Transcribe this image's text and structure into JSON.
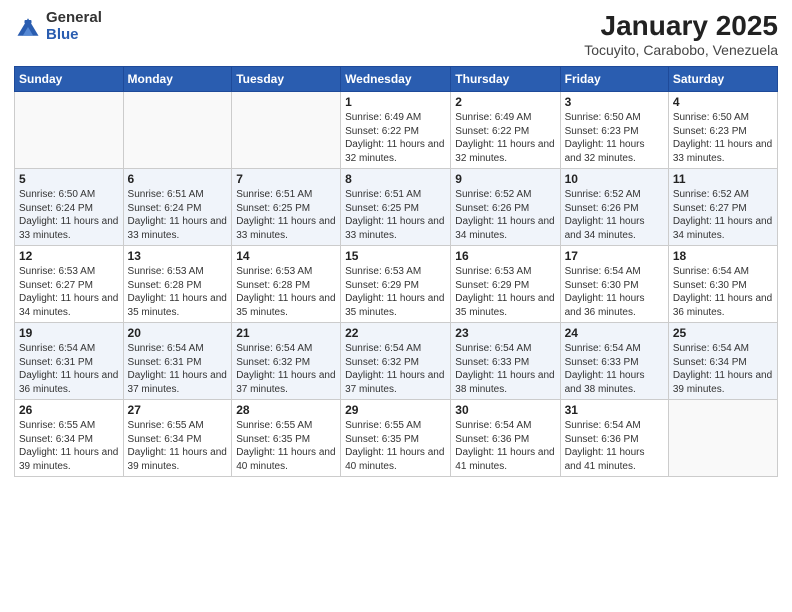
{
  "header": {
    "logo_general": "General",
    "logo_blue": "Blue",
    "title": "January 2025",
    "subtitle": "Tocuyito, Carabobo, Venezuela"
  },
  "days_of_week": [
    "Sunday",
    "Monday",
    "Tuesday",
    "Wednesday",
    "Thursday",
    "Friday",
    "Saturday"
  ],
  "weeks": [
    [
      {
        "day": "",
        "info": ""
      },
      {
        "day": "",
        "info": ""
      },
      {
        "day": "",
        "info": ""
      },
      {
        "day": "1",
        "info": "Sunrise: 6:49 AM\nSunset: 6:22 PM\nDaylight: 11 hours and 32 minutes."
      },
      {
        "day": "2",
        "info": "Sunrise: 6:49 AM\nSunset: 6:22 PM\nDaylight: 11 hours and 32 minutes."
      },
      {
        "day": "3",
        "info": "Sunrise: 6:50 AM\nSunset: 6:23 PM\nDaylight: 11 hours and 32 minutes."
      },
      {
        "day": "4",
        "info": "Sunrise: 6:50 AM\nSunset: 6:23 PM\nDaylight: 11 hours and 33 minutes."
      }
    ],
    [
      {
        "day": "5",
        "info": "Sunrise: 6:50 AM\nSunset: 6:24 PM\nDaylight: 11 hours and 33 minutes."
      },
      {
        "day": "6",
        "info": "Sunrise: 6:51 AM\nSunset: 6:24 PM\nDaylight: 11 hours and 33 minutes."
      },
      {
        "day": "7",
        "info": "Sunrise: 6:51 AM\nSunset: 6:25 PM\nDaylight: 11 hours and 33 minutes."
      },
      {
        "day": "8",
        "info": "Sunrise: 6:51 AM\nSunset: 6:25 PM\nDaylight: 11 hours and 33 minutes."
      },
      {
        "day": "9",
        "info": "Sunrise: 6:52 AM\nSunset: 6:26 PM\nDaylight: 11 hours and 34 minutes."
      },
      {
        "day": "10",
        "info": "Sunrise: 6:52 AM\nSunset: 6:26 PM\nDaylight: 11 hours and 34 minutes."
      },
      {
        "day": "11",
        "info": "Sunrise: 6:52 AM\nSunset: 6:27 PM\nDaylight: 11 hours and 34 minutes."
      }
    ],
    [
      {
        "day": "12",
        "info": "Sunrise: 6:53 AM\nSunset: 6:27 PM\nDaylight: 11 hours and 34 minutes."
      },
      {
        "day": "13",
        "info": "Sunrise: 6:53 AM\nSunset: 6:28 PM\nDaylight: 11 hours and 35 minutes."
      },
      {
        "day": "14",
        "info": "Sunrise: 6:53 AM\nSunset: 6:28 PM\nDaylight: 11 hours and 35 minutes."
      },
      {
        "day": "15",
        "info": "Sunrise: 6:53 AM\nSunset: 6:29 PM\nDaylight: 11 hours and 35 minutes."
      },
      {
        "day": "16",
        "info": "Sunrise: 6:53 AM\nSunset: 6:29 PM\nDaylight: 11 hours and 35 minutes."
      },
      {
        "day": "17",
        "info": "Sunrise: 6:54 AM\nSunset: 6:30 PM\nDaylight: 11 hours and 36 minutes."
      },
      {
        "day": "18",
        "info": "Sunrise: 6:54 AM\nSunset: 6:30 PM\nDaylight: 11 hours and 36 minutes."
      }
    ],
    [
      {
        "day": "19",
        "info": "Sunrise: 6:54 AM\nSunset: 6:31 PM\nDaylight: 11 hours and 36 minutes."
      },
      {
        "day": "20",
        "info": "Sunrise: 6:54 AM\nSunset: 6:31 PM\nDaylight: 11 hours and 37 minutes."
      },
      {
        "day": "21",
        "info": "Sunrise: 6:54 AM\nSunset: 6:32 PM\nDaylight: 11 hours and 37 minutes."
      },
      {
        "day": "22",
        "info": "Sunrise: 6:54 AM\nSunset: 6:32 PM\nDaylight: 11 hours and 37 minutes."
      },
      {
        "day": "23",
        "info": "Sunrise: 6:54 AM\nSunset: 6:33 PM\nDaylight: 11 hours and 38 minutes."
      },
      {
        "day": "24",
        "info": "Sunrise: 6:54 AM\nSunset: 6:33 PM\nDaylight: 11 hours and 38 minutes."
      },
      {
        "day": "25",
        "info": "Sunrise: 6:54 AM\nSunset: 6:34 PM\nDaylight: 11 hours and 39 minutes."
      }
    ],
    [
      {
        "day": "26",
        "info": "Sunrise: 6:55 AM\nSunset: 6:34 PM\nDaylight: 11 hours and 39 minutes."
      },
      {
        "day": "27",
        "info": "Sunrise: 6:55 AM\nSunset: 6:34 PM\nDaylight: 11 hours and 39 minutes."
      },
      {
        "day": "28",
        "info": "Sunrise: 6:55 AM\nSunset: 6:35 PM\nDaylight: 11 hours and 40 minutes."
      },
      {
        "day": "29",
        "info": "Sunrise: 6:55 AM\nSunset: 6:35 PM\nDaylight: 11 hours and 40 minutes."
      },
      {
        "day": "30",
        "info": "Sunrise: 6:54 AM\nSunset: 6:36 PM\nDaylight: 11 hours and 41 minutes."
      },
      {
        "day": "31",
        "info": "Sunrise: 6:54 AM\nSunset: 6:36 PM\nDaylight: 11 hours and 41 minutes."
      },
      {
        "day": "",
        "info": ""
      }
    ]
  ]
}
